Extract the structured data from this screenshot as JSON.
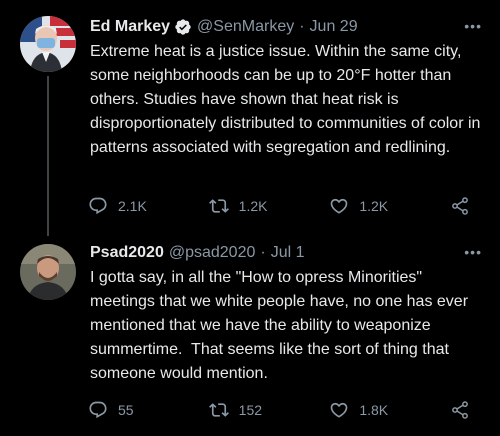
{
  "tweets": [
    {
      "name": "Ed Markey",
      "handle": "@SenMarkey",
      "separator": "·",
      "date": "Jun 29",
      "text": "Extreme heat is a justice issue. Within the same city, some neighborhoods can be up to 20°F hotter than others. Studies have shown that heat risk is disproportionately distributed to communities of color in patterns associated with segregation and redlining.",
      "verified": true,
      "replies": "2.1K",
      "retweets": "1.2K",
      "likes": "1.2K",
      "more": "•••"
    },
    {
      "name": "Psad2020",
      "handle": "@psad2020",
      "separator": "·",
      "date": "Jul 1",
      "text": "I gotta say, in all the \"How to opress Minorities\" meetings that we white people have, no one has ever mentioned that we have the ability to weaponize summertime.  That seems like the sort of thing that someone would mention.",
      "verified": false,
      "replies": "55",
      "retweets": "152",
      "likes": "1.8K",
      "more": "•••"
    }
  ],
  "colors": {
    "background": "#000000",
    "text_primary": "#e7e9ea",
    "text_secondary": "#8b98a5",
    "verified_badge": "#e7e9ea",
    "thread_line": "#3d4347"
  },
  "icons": [
    "verified-badge-icon",
    "more-icon",
    "reply-icon",
    "retweet-icon",
    "like-icon",
    "share-icon"
  ]
}
